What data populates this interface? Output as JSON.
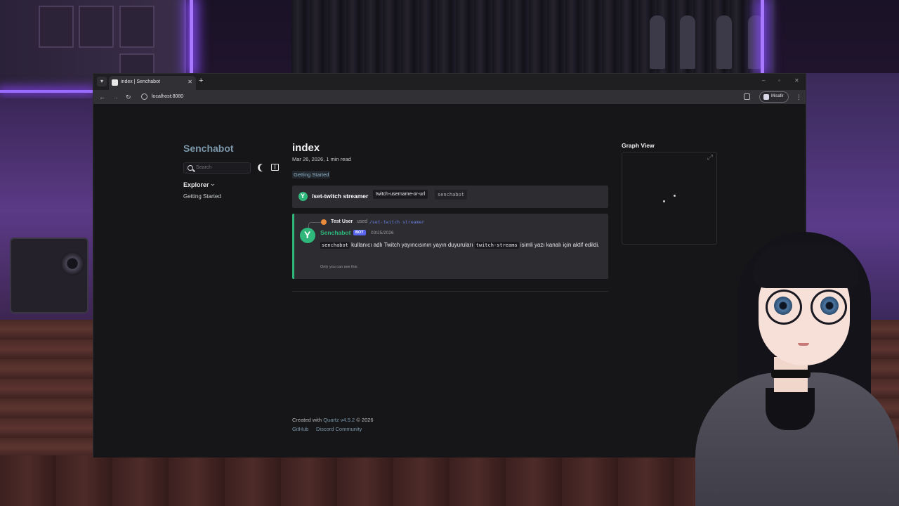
{
  "browser": {
    "tab_title": "index | Senchabot",
    "tab_close": "✕",
    "new_tab": "+",
    "url": "localhost:8080",
    "profile_label": "Misafir",
    "window_controls": [
      "–",
      "▫",
      "✕"
    ],
    "nav_icons": [
      "back-arrow-icon",
      "forward-arrow-icon",
      "reload-icon"
    ]
  },
  "sidebar": {
    "site_title": "Senchabot",
    "search_placeholder": "Search",
    "explorer_label": "Explorer",
    "items": [
      {
        "label": "Getting Started"
      }
    ]
  },
  "page": {
    "title": "index",
    "meta": "Mar 26, 2026,  1 min read",
    "tag": "Getting Started",
    "command": {
      "name": "/set-twitch streamer",
      "option": "twitch-username-or-url",
      "value": "senchabot"
    },
    "message": {
      "reply_user": "Test User",
      "reply_used": "used",
      "reply_command": "/set-twitch streamer",
      "bot_name": "Senchabot",
      "bot_badge": "BOT",
      "date": "03/25/2026",
      "code_1": "senchabot",
      "text_1": " kullanıcı adlı Twitch yayıncısının yayın duyuruları ",
      "code_2": "twitch-streams",
      "text_2": " isimli yazı kanalı için aktif edildi.",
      "note": "Only you can see this"
    },
    "footer": {
      "created_prefix": "Created with ",
      "quartz": "Quartz v4.5.2",
      "year": " © 2026",
      "links": [
        "GitHub",
        "Discord Community"
      ]
    }
  },
  "graph": {
    "title": "Graph View"
  },
  "colors": {
    "accent": "#7b97aa",
    "bot_green": "#2fb77b",
    "badge": "#5865f2",
    "page_bg": "#161618"
  }
}
